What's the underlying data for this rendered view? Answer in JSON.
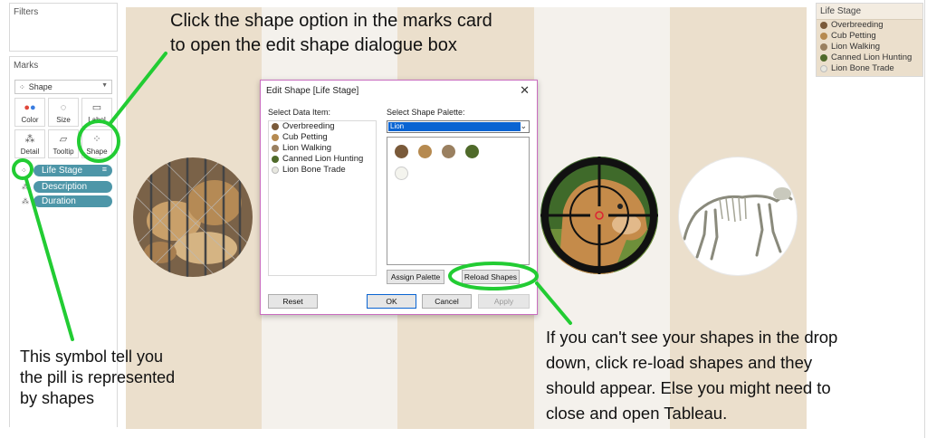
{
  "filters": {
    "title": "Filters"
  },
  "marks": {
    "title": "Marks",
    "mark_type": "Shape",
    "buttons": {
      "color": "Color",
      "size": "Size",
      "label": "Label",
      "detail": "Detail",
      "tooltip": "Tooltip",
      "shape": "Shape"
    },
    "pills": [
      "Life Stage",
      "Description",
      "Duration"
    ]
  },
  "legend": {
    "title": "Life Stage",
    "items": [
      "Overbreeding",
      "Cub Petting",
      "Lion Walking",
      "Canned Lion Hunting",
      "Lion Bone Trade"
    ]
  },
  "dialog": {
    "title": "Edit Shape [Life Stage]",
    "select_data_item_label": "Select Data Item:",
    "select_palette_label": "Select Shape Palette:",
    "data_items": [
      "Overbreeding",
      "Cub Petting",
      "Lion Walking",
      "Canned Lion Hunting",
      "Lion Bone Trade"
    ],
    "palette_value": "Lion",
    "assign_palette": "Assign Palette",
    "reload_shapes": "Reload Shapes",
    "reset": "Reset",
    "ok": "OK",
    "cancel": "Cancel",
    "apply": "Apply"
  },
  "annotations": {
    "top": "Click the shape option in the marks card\nto open the edit shape dialogue box",
    "bottom_left": "This symbol tell you\nthe pill is represented\nby shapes",
    "bottom_right": "If you can't see your shapes in the drop\ndown, click re-load shapes and they\nshould appear. Else you might need to\nclose and open Tableau."
  },
  "colors": {
    "band": "#ebdfcc",
    "pill": "#4d96a8",
    "highlight": "#22cc33",
    "select": "#0a64d2",
    "dialog_border": "#c96dc0"
  }
}
